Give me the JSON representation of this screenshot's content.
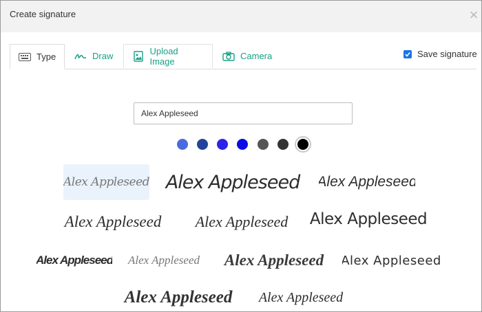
{
  "dialog": {
    "title": "Create signature"
  },
  "tabs": [
    {
      "label": "Type",
      "icon": "keyboard-icon"
    },
    {
      "label": "Draw",
      "icon": "scribble-icon"
    },
    {
      "label": "Upload Image",
      "icon": "image-icon"
    },
    {
      "label": "Camera",
      "icon": "camera-icon"
    }
  ],
  "save_signature": {
    "label": "Save signature",
    "checked": true
  },
  "name_input": {
    "value": "Alex Appleseed"
  },
  "colors": [
    {
      "hex": "#4a6be0"
    },
    {
      "hex": "#24449a"
    },
    {
      "hex": "#2e22e8"
    },
    {
      "hex": "#0a0ae6"
    },
    {
      "hex": "#555555"
    },
    {
      "hex": "#333333"
    },
    {
      "hex": "#000000",
      "selected": true
    }
  ],
  "signatures": [
    {
      "text": "Alex Appleseed",
      "selected": true
    },
    {
      "text": "Alex Appleseed"
    },
    {
      "text": "Alex Appleseed"
    },
    {
      "text": "Alex Appleseed"
    },
    {
      "text": "Alex Appleseed"
    },
    {
      "text": "Alex Appleseed"
    },
    {
      "text": "Alex Appleseed"
    },
    {
      "text": "Alex Appleseed"
    },
    {
      "text": "Alex Appleseed"
    },
    {
      "text": "Alex Appleseed"
    },
    {
      "text": "Alex Appleseed"
    },
    {
      "text": "Alex Appleseed"
    }
  ]
}
